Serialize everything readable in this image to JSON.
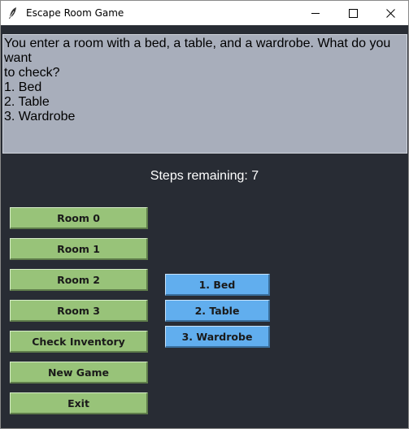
{
  "window": {
    "title": "Escape Room Game",
    "icon": "feather-icon",
    "controls": [
      "minimize-icon",
      "maximize-icon",
      "close-icon"
    ]
  },
  "textarea": {
    "lines": [
      "You enter a room with a bed, a table, and a wardrobe. What do you want",
      "to check?",
      "1. Bed",
      "2. Table",
      "3. Wardrobe"
    ]
  },
  "status": {
    "steps_text": "Steps remaining: 7"
  },
  "menu_buttons": [
    "Room 0",
    "Room 1",
    "Room 2",
    "Room 3",
    "Check Inventory",
    "New Game",
    "Exit"
  ],
  "choice_buttons": [
    "1. Bed",
    "2. Table",
    "3. Wardrobe"
  ],
  "colors": {
    "background": "#282c34",
    "textarea_bg": "#a8aebb",
    "menu_button": "#98c379",
    "choice_button": "#61aeee",
    "status_text": "#ffffff"
  }
}
